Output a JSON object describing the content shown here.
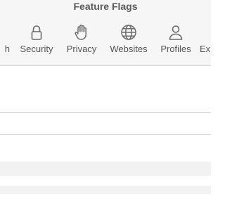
{
  "window": {
    "title": "Feature Flags"
  },
  "toolbar": {
    "tabs": [
      {
        "label": "h",
        "icon": "search-icon"
      },
      {
        "label": "Security",
        "icon": "lock-icon"
      },
      {
        "label": "Privacy",
        "icon": "hand-icon"
      },
      {
        "label": "Websites",
        "icon": "globe-icon"
      },
      {
        "label": "Profiles",
        "icon": "person-icon"
      },
      {
        "label": "Ex",
        "icon": "extensions-icon"
      }
    ]
  }
}
